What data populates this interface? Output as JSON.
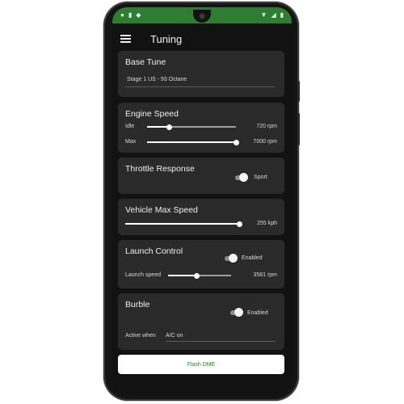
{
  "app": {
    "title": "Tuning"
  },
  "status": {
    "icons": [
      "notification-icon",
      "lock-icon",
      "shield-icon",
      "wifi-icon",
      "signal-icon",
      "battery-icon"
    ]
  },
  "base_tune": {
    "title": "Base Tune",
    "value": "Stage 1 US - 93 Octane"
  },
  "engine_speed": {
    "title": "Engine Speed",
    "idle_label": "Idle",
    "idle_value": "720 rpm",
    "idle_level": 0.25,
    "max_label": "Max",
    "max_value": "7000 rpm",
    "max_level": 1.0
  },
  "throttle": {
    "title": "Throttle Response",
    "value": "Sport",
    "enabled": true
  },
  "max_speed": {
    "title": "Vehicle Max Speed",
    "value": "255 kph",
    "level": 1.0
  },
  "launch": {
    "title": "Launch Control",
    "toggle_label": "Enabled",
    "enabled": true,
    "speed_label": "Launch speed",
    "speed_value": "3581 rpm",
    "speed_level": 0.45
  },
  "burble": {
    "title": "Burble",
    "toggle_label": "Enabled",
    "enabled": true,
    "active_label": "Active when",
    "active_value": "A/C on"
  },
  "actions": {
    "flash_label": "Flash DME"
  },
  "colors": {
    "accent": "#2e7d32",
    "card": "#2a2a2a",
    "background": "#121212"
  }
}
